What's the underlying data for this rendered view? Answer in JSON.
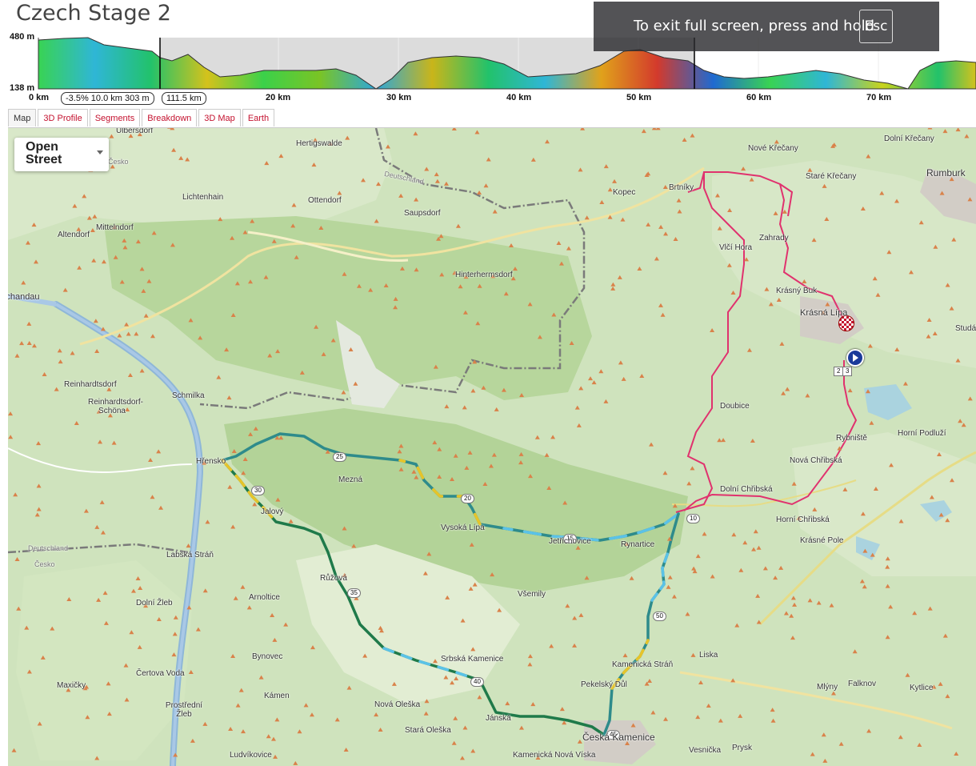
{
  "page": {
    "title": "Czech Stage 2"
  },
  "fullscreen_notice": {
    "text": "To exit full screen, press and hold",
    "key": "Esc"
  },
  "profile": {
    "ymax_label": "480 m",
    "ymin_label": "138 m",
    "x_labels": [
      "0 km",
      "20 km",
      "30 km",
      "40 km",
      "50 km",
      "60 km",
      "70 km"
    ],
    "segment_info": "-3.5% 10.0 km 303 m",
    "total_distance": "111.5 km"
  },
  "tabs": [
    {
      "label": "Map",
      "active": true
    },
    {
      "label": "3D Profile"
    },
    {
      "label": "Segments"
    },
    {
      "label": "Breakdown"
    },
    {
      "label": "3D Map"
    },
    {
      "label": "Earth"
    }
  ],
  "map": {
    "layer_selector": "Open Street",
    "places": [
      "Ulbersdorf",
      "Hertigswalde",
      "Nové Křečany",
      "Dolní Křečany",
      "Rumburk",
      "Lichtenhain",
      "Ottendorf",
      "Saupsdorf",
      "Kopec",
      "Brtníky",
      "Staré Křečany",
      "Altendorf",
      "Mittelndorf",
      "Hinterhermsdorf",
      "Zahrady",
      "Vlčí Hora",
      "Krásný Buk",
      "Krásná Lípa",
      "Studánka",
      "Schandau",
      "Reinhardtsdorf",
      "Reinhardtsdorf-Schöna",
      "Schmilka",
      "Doubice",
      "Rybniště",
      "Horní Podluží",
      "Hřensko",
      "Mezná",
      "Nová Chřibská",
      "Dolní Chřibská",
      "Jetřichovice",
      "Rynartice",
      "Vysoká Lípa",
      "Horní Chřibská",
      "Krásné Pole",
      "Jalový",
      "Labská Stráň",
      "Růžová",
      "Dolní Žleb",
      "Arnoltice",
      "Všemily",
      "Bynovec",
      "Liska",
      "Kamenická Stráň",
      "Pekelský Důl",
      "Srbská Kamenice",
      "Maxičky",
      "Čertova Voda",
      "Prostřední Žleb",
      "Kámen",
      "Nová Oleška",
      "Stará Oleška",
      "Česká Kamenice",
      "Mlýny",
      "Falknov",
      "Kytlice",
      "Vesnička",
      "Prysk",
      "Ludvíkovice",
      "Kamenická Nová Víska",
      "Deutschland",
      "Česko",
      "Deutschland",
      "Česko",
      "Jánská"
    ],
    "km_markers": [
      "25",
      "20",
      "15",
      "10",
      "30",
      "35",
      "40",
      "45",
      "50"
    ],
    "route_labels": [
      "2",
      "3"
    ]
  },
  "colors": {
    "route_pink": "#e0326e",
    "start_blue": "#1a3a9a",
    "finish_red": "#c4122f"
  }
}
